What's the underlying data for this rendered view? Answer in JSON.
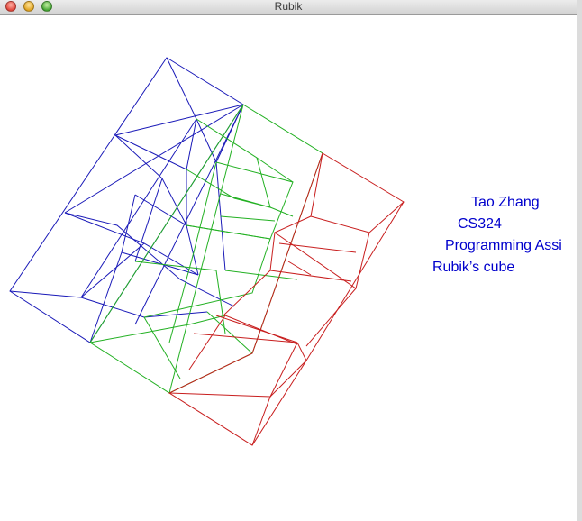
{
  "window": {
    "title": "Rubik"
  },
  "labels": {
    "line1": "Tao Zhang",
    "line2": "CS324",
    "line3": "Programming Assi",
    "line4": "Rubik’s cube"
  },
  "colors": {
    "blue_faces": "#1a1ab8",
    "green_faces": "#22b022",
    "red_faces": "#c81e1e",
    "label_text": "#0000cc"
  }
}
